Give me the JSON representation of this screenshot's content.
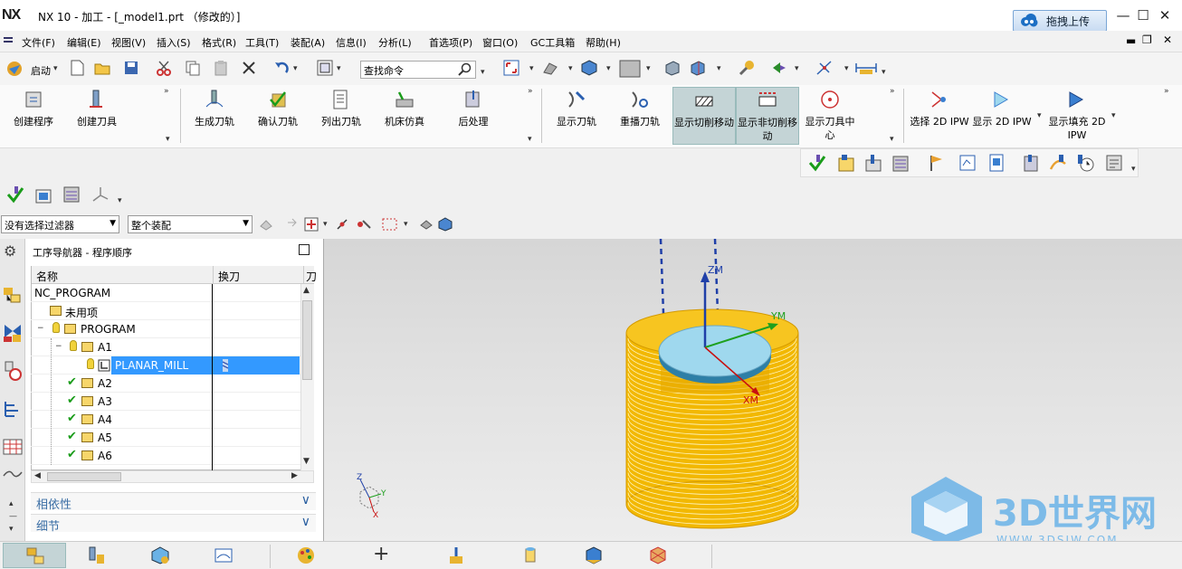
{
  "app": {
    "logo": "NX",
    "title": "NX 10 - 加工 - [_model1.prt （修改的）]",
    "upload_button": "拖拽上传"
  },
  "menubar": {
    "items": [
      "文件(F)",
      "编辑(E)",
      "视图(V)",
      "插入(S)",
      "格式(R)",
      "工具(T)",
      "装配(A)",
      "信息(I)",
      "分析(L)",
      "首选项(P)",
      "窗口(O)",
      "GC工具箱",
      "帮助(H)"
    ]
  },
  "toolbar": {
    "start_label": "启动",
    "search_placeholder": "查找命令"
  },
  "ribbon": {
    "group1": [
      "创建程序",
      "创建刀具"
    ],
    "group2": [
      "生成刀轨",
      "确认刀轨",
      "列出刀轨",
      "机床仿真",
      "后处理"
    ],
    "group3": [
      "显示刀轨",
      "重播刀轨",
      "显示切削移动",
      "显示非切削移动",
      "显示刀具中心"
    ],
    "group4": [
      "选择 2D IPW",
      "显示 2D IPW",
      "显示填充 2D IPW"
    ]
  },
  "filters": {
    "selection_filter": "没有选择过滤器",
    "assembly_scope": "整个装配"
  },
  "navigator": {
    "title": "工序导航器 - 程序顺序",
    "col_name": "名称",
    "col_tool_change": "换刀",
    "col_third": "刀",
    "rows": [
      {
        "label": "NC_PROGRAM",
        "level": 0
      },
      {
        "label": "未用项",
        "level": 1
      },
      {
        "label": "PROGRAM",
        "level": 1
      },
      {
        "label": "A1",
        "level": 2
      },
      {
        "label": "PLANAR_MILL",
        "level": 3,
        "selected": true
      },
      {
        "label": "A2",
        "level": 2
      },
      {
        "label": "A3",
        "level": 2
      },
      {
        "label": "A4",
        "level": 2
      },
      {
        "label": "A5",
        "level": 2
      },
      {
        "label": "A6",
        "level": 2
      }
    ],
    "accordion": [
      "相依性",
      "细节"
    ]
  },
  "viewport": {
    "axis_labels": {
      "zm": "ZM",
      "ym": "YM",
      "xm": "XM"
    },
    "triad": {
      "z": "Z",
      "y": "Y",
      "x": "X"
    },
    "watermark_title": "3D世界网",
    "watermark_url": "WWW.3DSJW.COM"
  },
  "colors": {
    "toolpath": "#f2b800",
    "part_top": "#9fd8ee",
    "selection": "#3399ff",
    "axis_blue": "#1f3fa8",
    "axis_green": "#1ea01e",
    "axis_red": "#c81010"
  }
}
